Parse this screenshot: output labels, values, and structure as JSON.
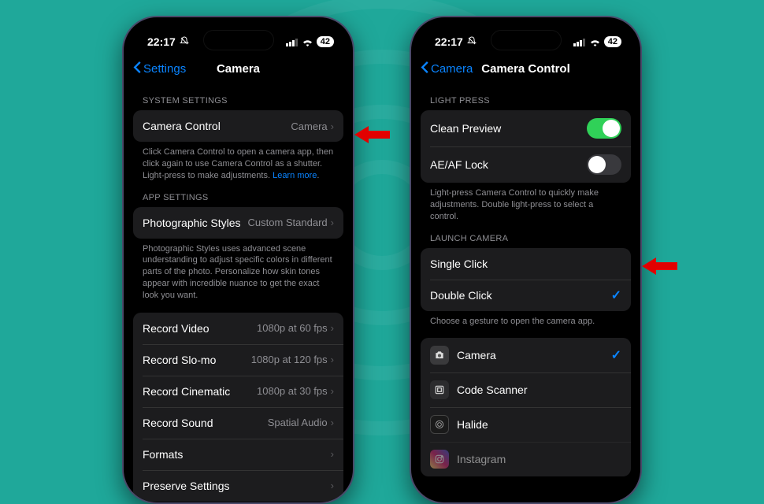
{
  "statusbar": {
    "time": "22:17",
    "battery": "42"
  },
  "leftPhone": {
    "backLabel": "Settings",
    "title": "Camera",
    "section1Header": "SYSTEM SETTINGS",
    "cameraControl": {
      "label": "Camera Control",
      "value": "Camera"
    },
    "footer1_a": "Click Camera Control to open a camera app, then click again to use Camera Control as a shutter. Light-press to make adjustments. ",
    "footer1_link": "Learn more",
    "section2Header": "APP SETTINGS",
    "photoStyles": {
      "label": "Photographic Styles",
      "value": "Custom Standard"
    },
    "footer2": "Photographic Styles uses advanced scene understanding to adjust specific colors in different parts of the photo. Personalize how skin tones appear with incredible nuance to get the exact look you want.",
    "rows": [
      {
        "label": "Record Video",
        "value": "1080p at 60 fps"
      },
      {
        "label": "Record Slo-mo",
        "value": "1080p at 120 fps"
      },
      {
        "label": "Record Cinematic",
        "value": "1080p at 30 fps"
      },
      {
        "label": "Record Sound",
        "value": "Spatial Audio"
      },
      {
        "label": "Formats",
        "value": ""
      },
      {
        "label": "Preserve Settings",
        "value": ""
      }
    ]
  },
  "rightPhone": {
    "backLabel": "Camera",
    "title": "Camera Control",
    "section1Header": "LIGHT PRESS",
    "cleanPreview": "Clean Preview",
    "aeafLock": "AE/AF Lock",
    "footer1": "Light-press Camera Control to quickly make adjustments. Double light-press to select a control.",
    "section2Header": "LAUNCH CAMERA",
    "singleClick": "Single Click",
    "doubleClick": "Double Click",
    "footer2": "Choose a gesture to open the camera app.",
    "apps": [
      {
        "label": "Camera",
        "checked": true,
        "iconClass": "camera"
      },
      {
        "label": "Code Scanner",
        "checked": false,
        "iconClass": "codescan"
      },
      {
        "label": "Halide",
        "checked": false,
        "iconClass": "halide"
      },
      {
        "label": "Instagram",
        "checked": false,
        "iconClass": "instagram",
        "faded": true
      }
    ]
  }
}
